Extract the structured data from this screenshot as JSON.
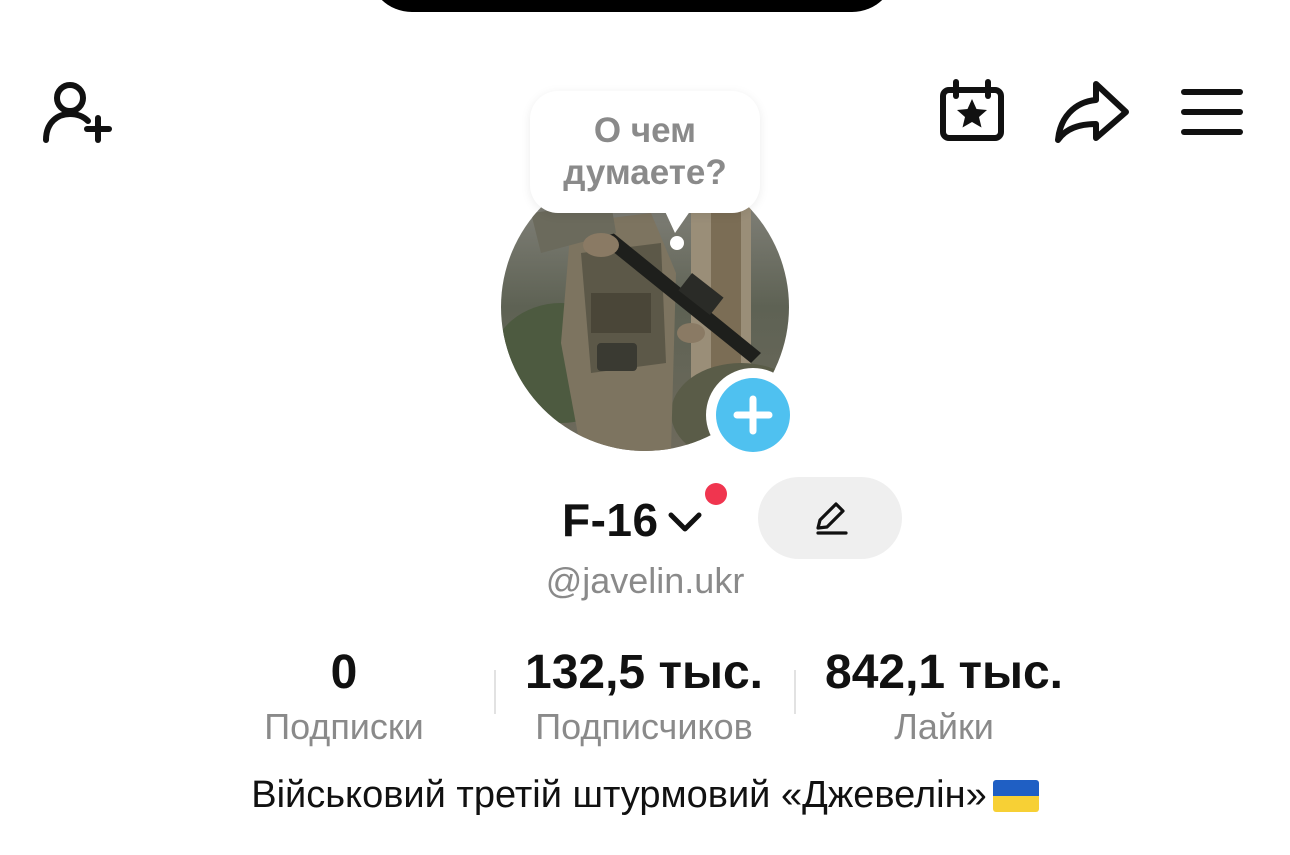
{
  "profile": {
    "thought_bubble": "О чем\nдумаете?",
    "display_name": "F-16",
    "username": "@javelin.ukr",
    "bio": "Військовий третій штурмовий «Джевелін»",
    "bio_flag": "ukraine-flag-icon"
  },
  "stats": {
    "following": {
      "value": "0",
      "label": "Подписки"
    },
    "followers": {
      "value": "132,5 тыс.",
      "label": "Подписчиков"
    },
    "likes": {
      "value": "842,1 тыс.",
      "label": "Лайки"
    }
  },
  "icons": {
    "top_left": "add-friend-icon",
    "top_right": [
      "calendar-star-icon",
      "share-icon",
      "menu-icon"
    ]
  },
  "colors": {
    "plus_badge": "#4fc1f0",
    "notification_dot": "#f0354f",
    "secondary_text": "#8a8a8a",
    "flag_blue": "#1f5fc4",
    "flag_yellow": "#f7d035"
  }
}
